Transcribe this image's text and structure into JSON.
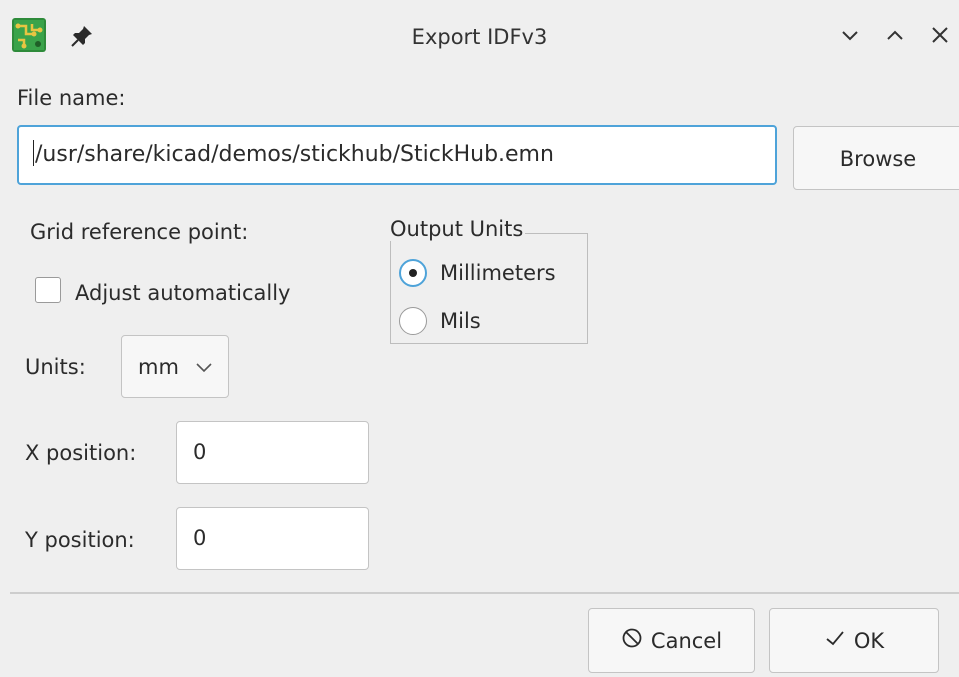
{
  "window": {
    "title": "Export IDFv3",
    "icons": [
      "kicad-pcb-app-icon",
      "pin-icon",
      "minimize-icon",
      "maximize-icon",
      "close-icon"
    ]
  },
  "file": {
    "label": "File name:",
    "value": "/usr/share/kicad/demos/stickhub/StickHub.emn",
    "browse_label": "Browse"
  },
  "grid": {
    "label": "Grid reference point:",
    "adjust_label": "Adjust automatically",
    "adjust_checked": false,
    "units_label": "Units:",
    "units_value": "mm",
    "x_label": "X position:",
    "x_value": "0",
    "y_label": "Y position:",
    "y_value": "0"
  },
  "output_units": {
    "title": "Output Units",
    "options": [
      {
        "label": "Millimeters",
        "checked": true
      },
      {
        "label": "Mils",
        "checked": false
      }
    ]
  },
  "buttons": {
    "cancel_label": "Cancel",
    "ok_label": "OK"
  },
  "colors": {
    "background": "#efefef",
    "focus_accent": "#4ea3d9",
    "icon_green": "#2e8b3a"
  }
}
